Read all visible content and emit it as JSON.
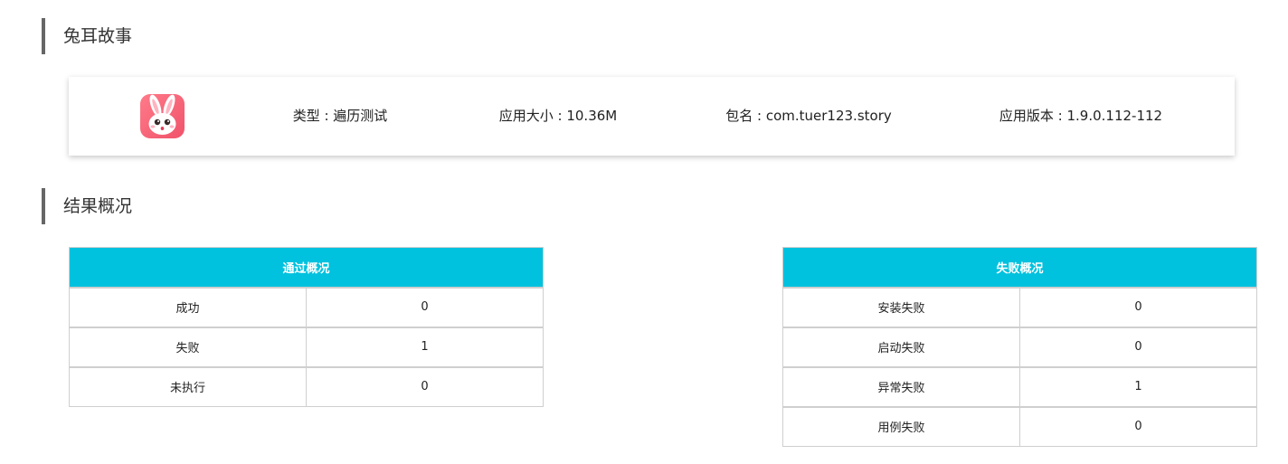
{
  "app_section": {
    "title": "兔耳故事",
    "icon": "bunny-app-icon",
    "type": "类型 : 遍历测试",
    "size": "应用大小 : 10.36M",
    "package": "包名 : com.tuer123.story",
    "version": "应用版本 : 1.9.0.112-112"
  },
  "result_section": {
    "title": "结果概况",
    "pass_table": {
      "header": "通过概况",
      "rows": [
        {
          "label": "成功",
          "value": "0"
        },
        {
          "label": "失败",
          "value": "1"
        },
        {
          "label": "未执行",
          "value": "0"
        }
      ]
    },
    "fail_table": {
      "header": "失败概况",
      "rows": [
        {
          "label": "安装失败",
          "value": "0"
        },
        {
          "label": "启动失败",
          "value": "0"
        },
        {
          "label": "异常失败",
          "value": "1"
        },
        {
          "label": "用例失败",
          "value": "0"
        }
      ]
    }
  },
  "colors": {
    "table_header": "#00c1de",
    "section_bar": "#666666",
    "icon_bg": "#f0526a"
  }
}
